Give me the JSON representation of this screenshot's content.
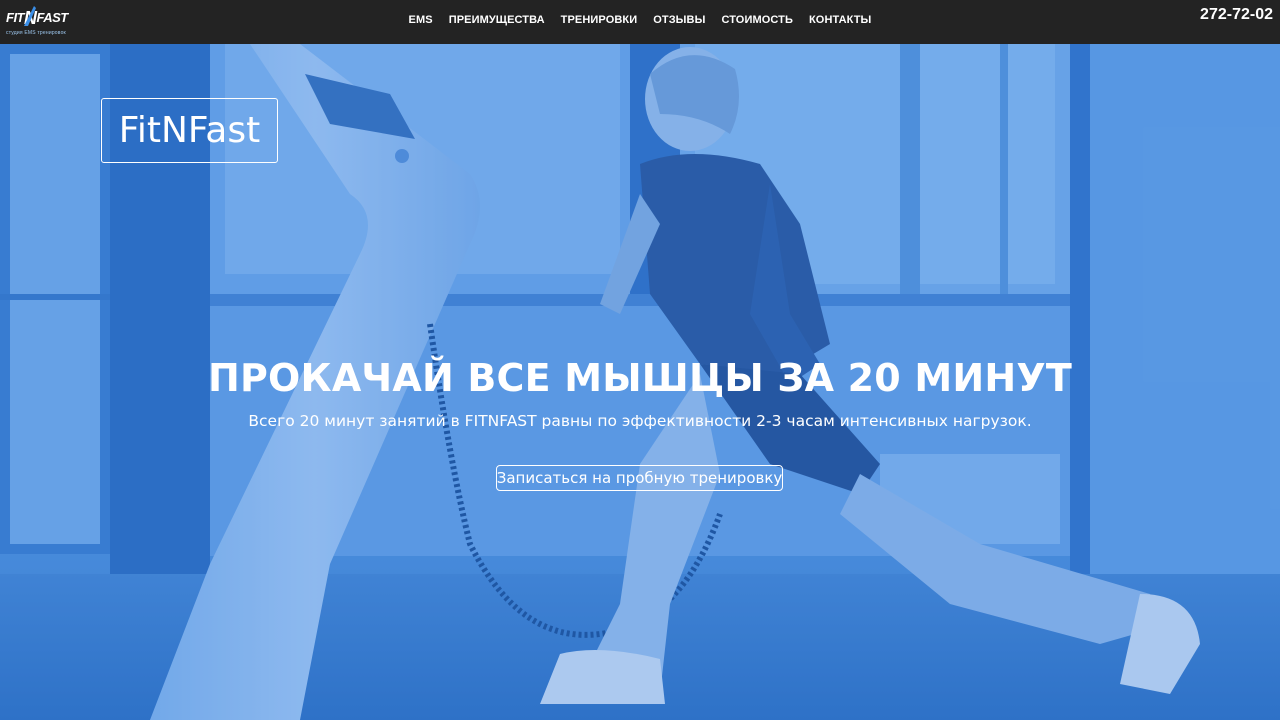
{
  "header": {
    "logo": {
      "wordmark": "FITNFAST",
      "tagline": "студия EMS тренировок"
    },
    "nav": [
      {
        "label": "EMS"
      },
      {
        "label": "ПРЕИМУЩЕСТВА"
      },
      {
        "label": "ТРЕНИРОВКИ"
      },
      {
        "label": "ОТЗЫВЫ"
      },
      {
        "label": "СТОИМОСТЬ"
      },
      {
        "label": "КОНТАКТЫ"
      }
    ],
    "phone": "272-72-02"
  },
  "hero": {
    "brand": "FitNFast",
    "headline": "ПРОКАЧАЙ ВСЕ МЫШЦЫ ЗА 20 МИНУТ",
    "subheadline": "Всего 20 минут занятий в FITNFAST равны по эффективности 2-3 часам интенсивных нагрузок.",
    "cta_label": "Записаться на пробную тренировку",
    "overlay_color": "#3a8ae0"
  }
}
